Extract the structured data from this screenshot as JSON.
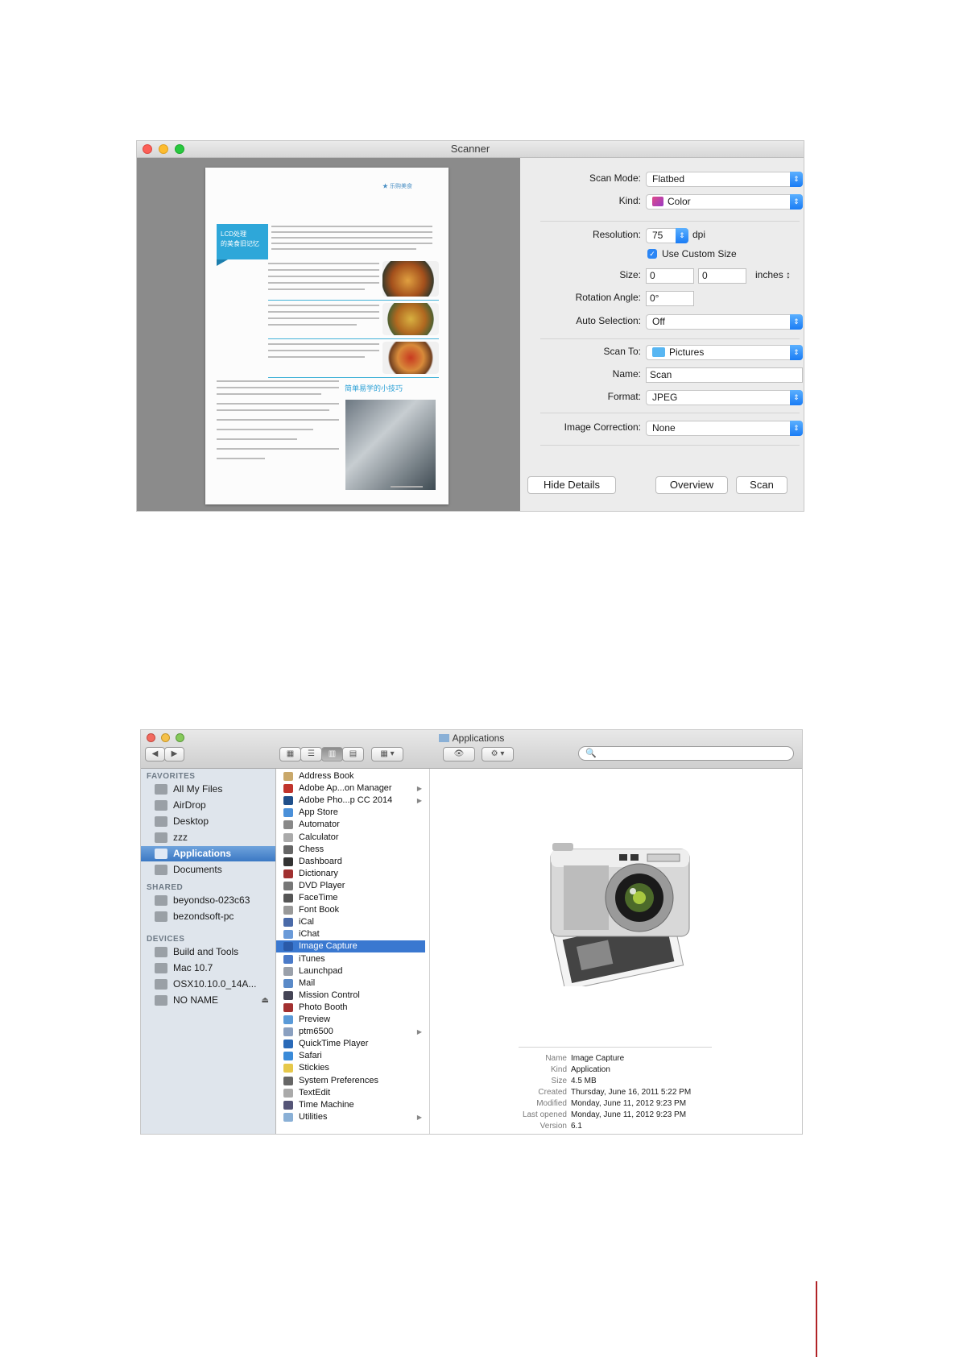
{
  "scanner": {
    "title": "Scanner",
    "preview": {
      "page_header": "★ 乐购美食",
      "box_text": "LCD处理\n的美食旧记忆",
      "section_heading": "简单易学的小技巧"
    },
    "scan_mode": {
      "label": "Scan Mode:",
      "value": "Flatbed"
    },
    "kind": {
      "label": "Kind:",
      "value": "Color"
    },
    "resolution": {
      "label": "Resolution:",
      "value": "75",
      "unit": "dpi"
    },
    "custom_size": {
      "label": "Use Custom Size",
      "checked": true
    },
    "size": {
      "label": "Size:",
      "width": "0",
      "height": "0",
      "unit": "inches ↕"
    },
    "rotation": {
      "label": "Rotation Angle:",
      "value": "0°"
    },
    "auto_selection": {
      "label": "Auto Selection:",
      "value": "Off"
    },
    "scan_to": {
      "label": "Scan To:",
      "value": "Pictures"
    },
    "name": {
      "label": "Name:",
      "value": "Scan"
    },
    "format": {
      "label": "Format:",
      "value": "JPEG"
    },
    "image_correction": {
      "label": "Image Correction:",
      "value": "None"
    },
    "buttons": {
      "hide_details": "Hide Details",
      "overview": "Overview",
      "scan": "Scan"
    }
  },
  "finder": {
    "title": "Applications",
    "search": {
      "placeholder": "🔍"
    },
    "sidebar": {
      "favorites_header": "FAVORITES",
      "favorites": [
        "All My Files",
        "AirDrop",
        "Desktop",
        "zzz",
        "Applications",
        "Documents"
      ],
      "shared_header": "SHARED",
      "shared": [
        "beyondso-023c63",
        "bezondsoft-pc"
      ],
      "devices_header": "DEVICES",
      "devices": [
        "Build and Tools",
        "Mac 10.7",
        "OSX10.10.0_14A...",
        "NO NAME"
      ]
    },
    "apps": [
      "Address Book",
      "Adobe Ap...on Manager",
      "Adobe Pho...p CC 2014",
      "App Store",
      "Automator",
      "Calculator",
      "Chess",
      "Dashboard",
      "Dictionary",
      "DVD Player",
      "FaceTime",
      "Font Book",
      "iCal",
      "iChat",
      "Image Capture",
      "iTunes",
      "Launchpad",
      "Mail",
      "Mission Control",
      "Photo Booth",
      "Preview",
      "ptm6500",
      "QuickTime Player",
      "Safari",
      "Stickies",
      "System Preferences",
      "TextEdit",
      "Time Machine",
      "Utilities"
    ],
    "selected_app": "Image Capture",
    "info": {
      "labels": {
        "name": "Name",
        "kind": "Kind",
        "size": "Size",
        "created": "Created",
        "modified": "Modified",
        "last_opened": "Last opened",
        "version": "Version"
      },
      "name": "Image Capture",
      "kind": "Application",
      "size": "4.5 MB",
      "created": "Thursday, June 16, 2011 5:22 PM",
      "modified": "Monday, June 11, 2012 9:23 PM",
      "last_opened": "Monday, June 11, 2012 9:23 PM",
      "version": "6.1"
    }
  },
  "colors": {
    "accent_blue": "#2b86f5",
    "selection_blue": "#3a78d0",
    "page_rule_red": "#b02226"
  }
}
